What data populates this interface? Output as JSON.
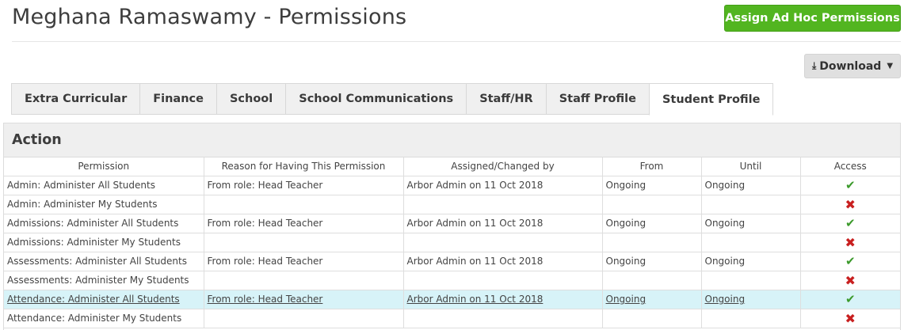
{
  "header": {
    "title": "Meghana Ramaswamy - Permissions",
    "assign_button": "Assign Ad Hoc Permissions",
    "download_button": "Download",
    "download_icon": "⤓",
    "caret_icon": "▼"
  },
  "tabs": [
    {
      "label": "Extra Curricular",
      "active": false
    },
    {
      "label": "Finance",
      "active": false
    },
    {
      "label": "School",
      "active": false
    },
    {
      "label": "School Communications",
      "active": false
    },
    {
      "label": "Staff/HR",
      "active": false
    },
    {
      "label": "Staff Profile",
      "active": false
    },
    {
      "label": "Student Profile",
      "active": true
    }
  ],
  "panel": {
    "title": "Action",
    "columns": [
      "Permission",
      "Reason for Having This Permission",
      "Assigned/Changed by",
      "From",
      "Until",
      "Access"
    ],
    "rows": [
      {
        "permission": "Admin: Administer All Students",
        "reason": "From role: Head Teacher",
        "assigned": "Arbor Admin on 11 Oct 2018",
        "from": "Ongoing",
        "until": "Ongoing",
        "access": true,
        "highlighted": false
      },
      {
        "permission": "Admin: Administer My Students",
        "reason": "",
        "assigned": "",
        "from": "",
        "until": "",
        "access": false,
        "highlighted": false
      },
      {
        "permission": "Admissions: Administer All Students",
        "reason": "From role: Head Teacher",
        "assigned": "Arbor Admin on 11 Oct 2018",
        "from": "Ongoing",
        "until": "Ongoing",
        "access": true,
        "highlighted": false
      },
      {
        "permission": "Admissions: Administer My Students",
        "reason": "",
        "assigned": "",
        "from": "",
        "until": "",
        "access": false,
        "highlighted": false
      },
      {
        "permission": "Assessments: Administer All Students",
        "reason": "From role: Head Teacher",
        "assigned": "Arbor Admin on 11 Oct 2018",
        "from": "Ongoing",
        "until": "Ongoing",
        "access": true,
        "highlighted": false
      },
      {
        "permission": "Assessments: Administer My Students",
        "reason": "",
        "assigned": "",
        "from": "",
        "until": "",
        "access": false,
        "highlighted": false
      },
      {
        "permission": "Attendance: Administer All Students",
        "reason": "From role: Head Teacher",
        "assigned": "Arbor Admin on 11 Oct 2018",
        "from": "Ongoing",
        "until": "Ongoing",
        "access": true,
        "highlighted": true
      },
      {
        "permission": "Attendance: Administer My Students",
        "reason": "",
        "assigned": "",
        "from": "",
        "until": "",
        "access": false,
        "highlighted": false
      }
    ]
  },
  "icons": {
    "check": "✔",
    "cross": "✖",
    "check_color": "#3c9a2c",
    "cross_color": "#c81f1f"
  },
  "colors": {
    "accent_green": "#52b520",
    "highlight_row": "#d7f3f8"
  }
}
